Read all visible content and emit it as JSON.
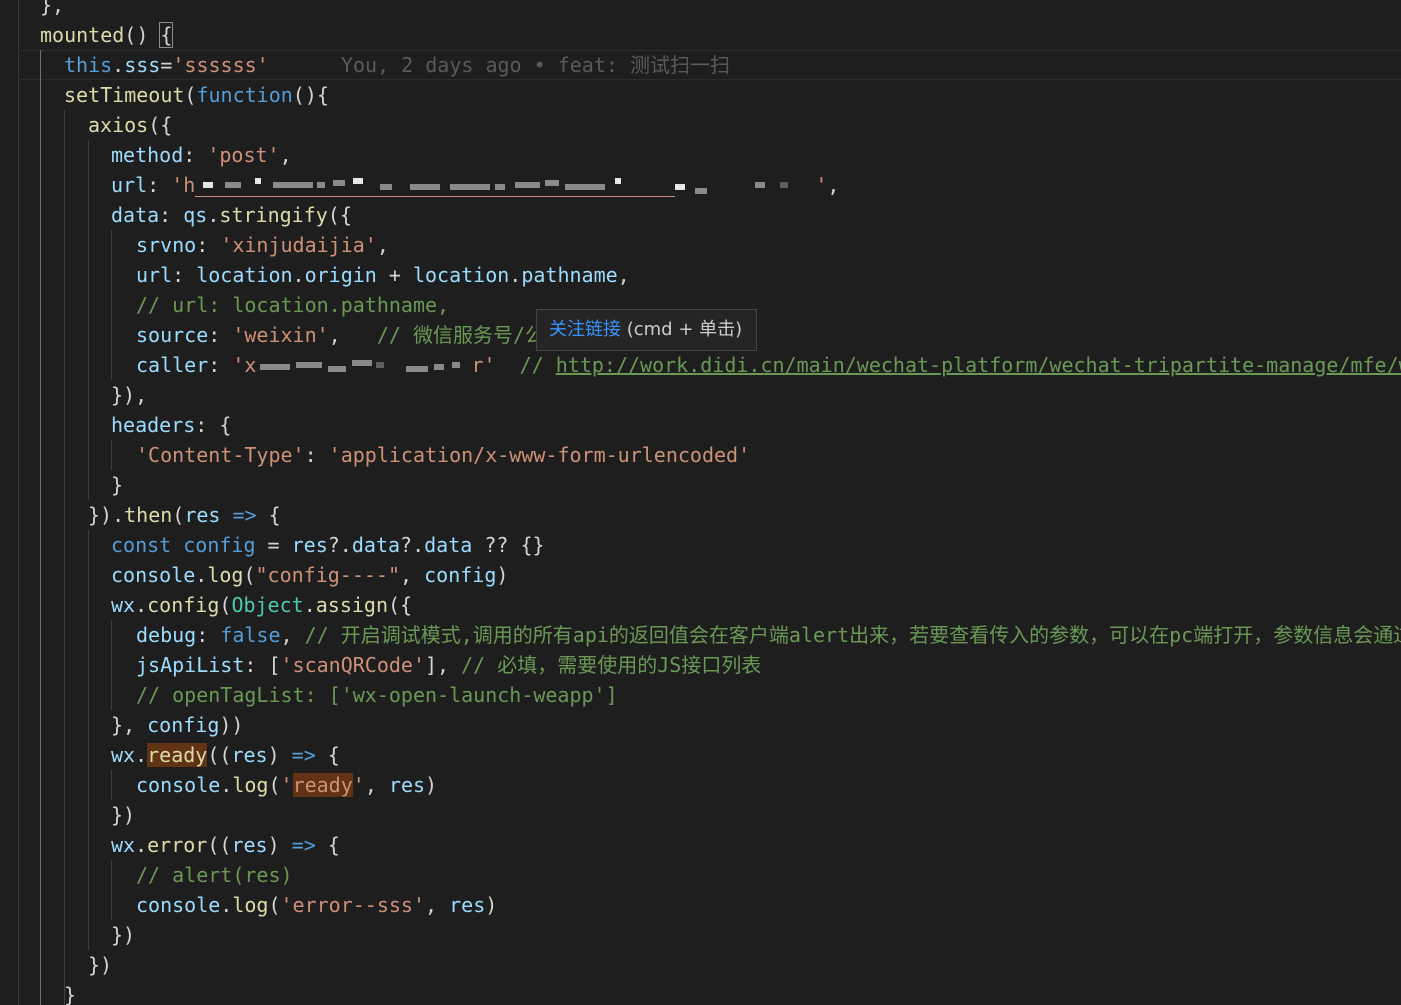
{
  "editor": {
    "lines": [
      {
        "segments": [
          {
            "t": "}",
            "c": "pun"
          },
          {
            "t": ",",
            "c": "pun"
          }
        ]
      },
      {
        "segments": [
          {
            "t": "mounted",
            "c": "fn"
          },
          {
            "t": "() ",
            "c": "pun"
          },
          {
            "t": "{",
            "c": "pun bracket-hl"
          }
        ]
      },
      {
        "segments": [
          {
            "t": "this",
            "c": "kw"
          },
          {
            "t": ".",
            "c": "pun"
          },
          {
            "t": "sss",
            "c": "var"
          },
          {
            "t": "=",
            "c": "pun"
          },
          {
            "t": "'ssssss'",
            "c": "str"
          },
          {
            "t": "      You, 2 days ago • feat: 测试扫一扫",
            "c": "blame"
          }
        ]
      },
      {
        "segments": [
          {
            "t": "setTimeout",
            "c": "fn"
          },
          {
            "t": "(",
            "c": "pun"
          },
          {
            "t": "function",
            "c": "kw"
          },
          {
            "t": "(){",
            "c": "pun"
          }
        ]
      },
      {
        "segments": [
          {
            "t": "axios",
            "c": "fn"
          },
          {
            "t": "({",
            "c": "pun"
          }
        ]
      },
      {
        "segments": [
          {
            "t": "method",
            "c": "var"
          },
          {
            "t": ": ",
            "c": "pun"
          },
          {
            "t": "'post'",
            "c": "str"
          },
          {
            "t": ",",
            "c": "pun"
          }
        ]
      },
      {
        "segments": [
          {
            "t": "url",
            "c": "var"
          },
          {
            "t": ": ",
            "c": "pun"
          },
          {
            "t": "'h",
            "c": "str"
          },
          {
            "t": "",
            "c": "redact"
          },
          {
            "t": "'",
            "c": "str"
          },
          {
            "t": ",",
            "c": "pun"
          }
        ]
      },
      {
        "segments": [
          {
            "t": "data",
            "c": "var"
          },
          {
            "t": ": ",
            "c": "pun"
          },
          {
            "t": "qs",
            "c": "var"
          },
          {
            "t": ".",
            "c": "pun"
          },
          {
            "t": "stringify",
            "c": "fn"
          },
          {
            "t": "({",
            "c": "pun"
          }
        ]
      },
      {
        "segments": [
          {
            "t": "srvno",
            "c": "var"
          },
          {
            "t": ": ",
            "c": "pun"
          },
          {
            "t": "'xinjudaijia'",
            "c": "str"
          },
          {
            "t": ",",
            "c": "pun"
          }
        ]
      },
      {
        "segments": [
          {
            "t": "url",
            "c": "var"
          },
          {
            "t": ": ",
            "c": "pun"
          },
          {
            "t": "location",
            "c": "var"
          },
          {
            "t": ".",
            "c": "pun"
          },
          {
            "t": "origin",
            "c": "var"
          },
          {
            "t": " + ",
            "c": "pun"
          },
          {
            "t": "location",
            "c": "var"
          },
          {
            "t": ".",
            "c": "pun"
          },
          {
            "t": "pathname",
            "c": "var"
          },
          {
            "t": ",",
            "c": "pun"
          }
        ]
      },
      {
        "segments": [
          {
            "t": "// url: location.pathname,",
            "c": "cm"
          }
        ]
      },
      {
        "segments": [
          {
            "t": "source",
            "c": "var"
          },
          {
            "t": ": ",
            "c": "pun"
          },
          {
            "t": "'weixin'",
            "c": "str"
          },
          {
            "t": ",   ",
            "c": "pun"
          },
          {
            "t": "// 微信服务号/公",
            "c": "cm"
          }
        ]
      },
      {
        "segments": [
          {
            "t": "caller",
            "c": "var"
          },
          {
            "t": ": ",
            "c": "pun"
          },
          {
            "t": "'x",
            "c": "str"
          },
          {
            "t": "",
            "c": "redact2"
          },
          {
            "t": "r'",
            "c": "str"
          },
          {
            "t": "  // ",
            "c": "cm"
          },
          {
            "t": "http://work.didi.cn/main/wechat-platform/wechat-tripartite-manage/mfe/we",
            "c": "link"
          }
        ]
      },
      {
        "segments": [
          {
            "t": "}),",
            "c": "pun"
          }
        ]
      },
      {
        "segments": [
          {
            "t": "headers",
            "c": "var"
          },
          {
            "t": ": {",
            "c": "pun"
          }
        ]
      },
      {
        "segments": [
          {
            "t": "'Content-Type'",
            "c": "str"
          },
          {
            "t": ": ",
            "c": "pun"
          },
          {
            "t": "'application/x-www-form-urlencoded'",
            "c": "str"
          }
        ]
      },
      {
        "segments": [
          {
            "t": "}",
            "c": "pun"
          }
        ]
      },
      {
        "segments": [
          {
            "t": "}).",
            "c": "pun"
          },
          {
            "t": "then",
            "c": "fn"
          },
          {
            "t": "(",
            "c": "pun"
          },
          {
            "t": "res",
            "c": "var"
          },
          {
            "t": " ",
            "c": "pun"
          },
          {
            "t": "=>",
            "c": "kw"
          },
          {
            "t": " {",
            "c": "pun"
          }
        ]
      },
      {
        "segments": [
          {
            "t": "const",
            "c": "kw"
          },
          {
            "t": " ",
            "c": "pun"
          },
          {
            "t": "config",
            "c": "kw"
          },
          {
            "t": " = ",
            "c": "pun"
          },
          {
            "t": "res",
            "c": "var"
          },
          {
            "t": "?.",
            "c": "pun"
          },
          {
            "t": "data",
            "c": "var"
          },
          {
            "t": "?.",
            "c": "pun"
          },
          {
            "t": "data",
            "c": "var"
          },
          {
            "t": " ?? {}",
            "c": "pun"
          }
        ]
      },
      {
        "segments": [
          {
            "t": "console",
            "c": "var"
          },
          {
            "t": ".",
            "c": "pun"
          },
          {
            "t": "log",
            "c": "fn"
          },
          {
            "t": "(",
            "c": "pun"
          },
          {
            "t": "\"config----\"",
            "c": "str"
          },
          {
            "t": ", ",
            "c": "pun"
          },
          {
            "t": "config",
            "c": "var"
          },
          {
            "t": ")",
            "c": "pun"
          }
        ]
      },
      {
        "segments": [
          {
            "t": "wx",
            "c": "var"
          },
          {
            "t": ".",
            "c": "pun"
          },
          {
            "t": "config",
            "c": "fn"
          },
          {
            "t": "(",
            "c": "pun"
          },
          {
            "t": "Object",
            "c": "cls"
          },
          {
            "t": ".",
            "c": "pun"
          },
          {
            "t": "assign",
            "c": "fn"
          },
          {
            "t": "({",
            "c": "pun"
          }
        ]
      },
      {
        "segments": [
          {
            "t": "debug",
            "c": "var"
          },
          {
            "t": ": ",
            "c": "pun"
          },
          {
            "t": "false",
            "c": "kw"
          },
          {
            "t": ", ",
            "c": "pun"
          },
          {
            "t": "// 开启调试模式,调用的所有api的返回值会在客户端alert出来，若要查看传入的参数，可以在pc端打开，参数信息会通过",
            "c": "cm"
          }
        ]
      },
      {
        "segments": [
          {
            "t": "jsApiList",
            "c": "var"
          },
          {
            "t": ": [",
            "c": "pun"
          },
          {
            "t": "'scanQRCode'",
            "c": "str"
          },
          {
            "t": "], ",
            "c": "pun"
          },
          {
            "t": "// 必填，需要使用的JS接口列表",
            "c": "cm"
          }
        ]
      },
      {
        "segments": [
          {
            "t": "// openTagList: ['wx-open-launch-weapp']",
            "c": "cm"
          }
        ]
      },
      {
        "segments": [
          {
            "t": "}, ",
            "c": "pun"
          },
          {
            "t": "config",
            "c": "var"
          },
          {
            "t": "))",
            "c": "pun"
          }
        ]
      },
      {
        "segments": [
          {
            "t": "wx",
            "c": "var"
          },
          {
            "t": ".",
            "c": "pun"
          },
          {
            "t": "ready",
            "c": "fn ready-hl"
          },
          {
            "t": "((",
            "c": "pun"
          },
          {
            "t": "res",
            "c": "var"
          },
          {
            "t": ") ",
            "c": "pun"
          },
          {
            "t": "=>",
            "c": "kw"
          },
          {
            "t": " {",
            "c": "pun"
          }
        ]
      },
      {
        "segments": [
          {
            "t": "console",
            "c": "var"
          },
          {
            "t": ".",
            "c": "pun"
          },
          {
            "t": "log",
            "c": "fn"
          },
          {
            "t": "(",
            "c": "pun"
          },
          {
            "t": "'",
            "c": "str"
          },
          {
            "t": "ready",
            "c": "str ready-hl"
          },
          {
            "t": "'",
            "c": "str"
          },
          {
            "t": ", ",
            "c": "pun"
          },
          {
            "t": "res",
            "c": "var"
          },
          {
            "t": ")",
            "c": "pun"
          }
        ]
      },
      {
        "segments": [
          {
            "t": "})",
            "c": "pun"
          }
        ]
      },
      {
        "segments": [
          {
            "t": "wx",
            "c": "var"
          },
          {
            "t": ".",
            "c": "pun"
          },
          {
            "t": "error",
            "c": "fn"
          },
          {
            "t": "((",
            "c": "pun"
          },
          {
            "t": "res",
            "c": "var"
          },
          {
            "t": ") ",
            "c": "pun"
          },
          {
            "t": "=>",
            "c": "kw"
          },
          {
            "t": " {",
            "c": "pun"
          }
        ]
      },
      {
        "segments": [
          {
            "t": "// alert(res)",
            "c": "cm"
          }
        ]
      },
      {
        "segments": [
          {
            "t": "console",
            "c": "var"
          },
          {
            "t": ".",
            "c": "pun"
          },
          {
            "t": "log",
            "c": "fn"
          },
          {
            "t": "(",
            "c": "pun"
          },
          {
            "t": "'error--sss'",
            "c": "str"
          },
          {
            "t": ", ",
            "c": "pun"
          },
          {
            "t": "res",
            "c": "var"
          },
          {
            "t": ")",
            "c": "pun"
          }
        ]
      },
      {
        "segments": [
          {
            "t": "})",
            "c": "pun"
          }
        ]
      },
      {
        "segments": [
          {
            "t": "})",
            "c": "pun"
          }
        ]
      },
      {
        "segments": [
          {
            "t": "}",
            "c": "pun"
          }
        ]
      }
    ]
  },
  "tooltip": {
    "link_label": "关注链接",
    "shortcut": " (cmd + 单击)"
  }
}
